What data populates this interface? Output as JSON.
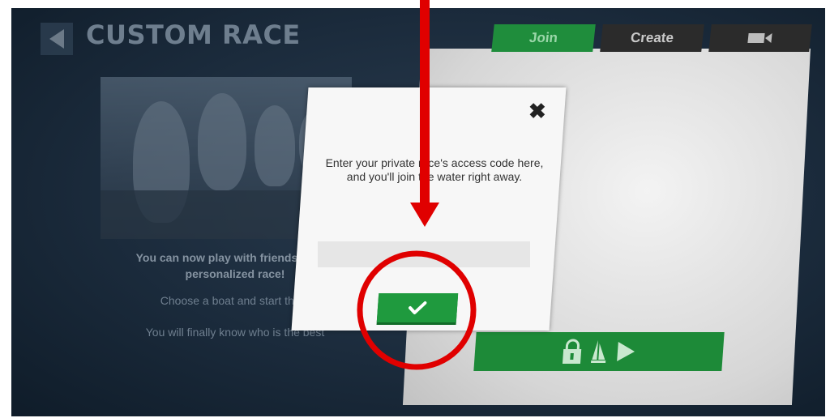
{
  "header": {
    "title": "CUSTOM RACE"
  },
  "left_panel": {
    "intro_line1": "You can now play with friends by cre",
    "intro_line2": "personalized race!",
    "line2": "Choose a boat and start the g",
    "line3": "You will finally know who is the best"
  },
  "tabs": [
    {
      "label": "Join",
      "active": true
    },
    {
      "label": "Create",
      "active": false
    },
    {
      "label": "",
      "icon": "video-camera-icon",
      "active": false
    }
  ],
  "dialog": {
    "message": "Enter your private race's access code here, and you'll join the water right away.",
    "close_symbol": "✖",
    "input": {
      "value": "",
      "placeholder": ""
    },
    "confirm_icon": "checkmark-icon"
  },
  "colors": {
    "accent_green": "#1f9a3e",
    "tab_dark": "#2b2b2b",
    "annotation_red": "#e00000"
  }
}
